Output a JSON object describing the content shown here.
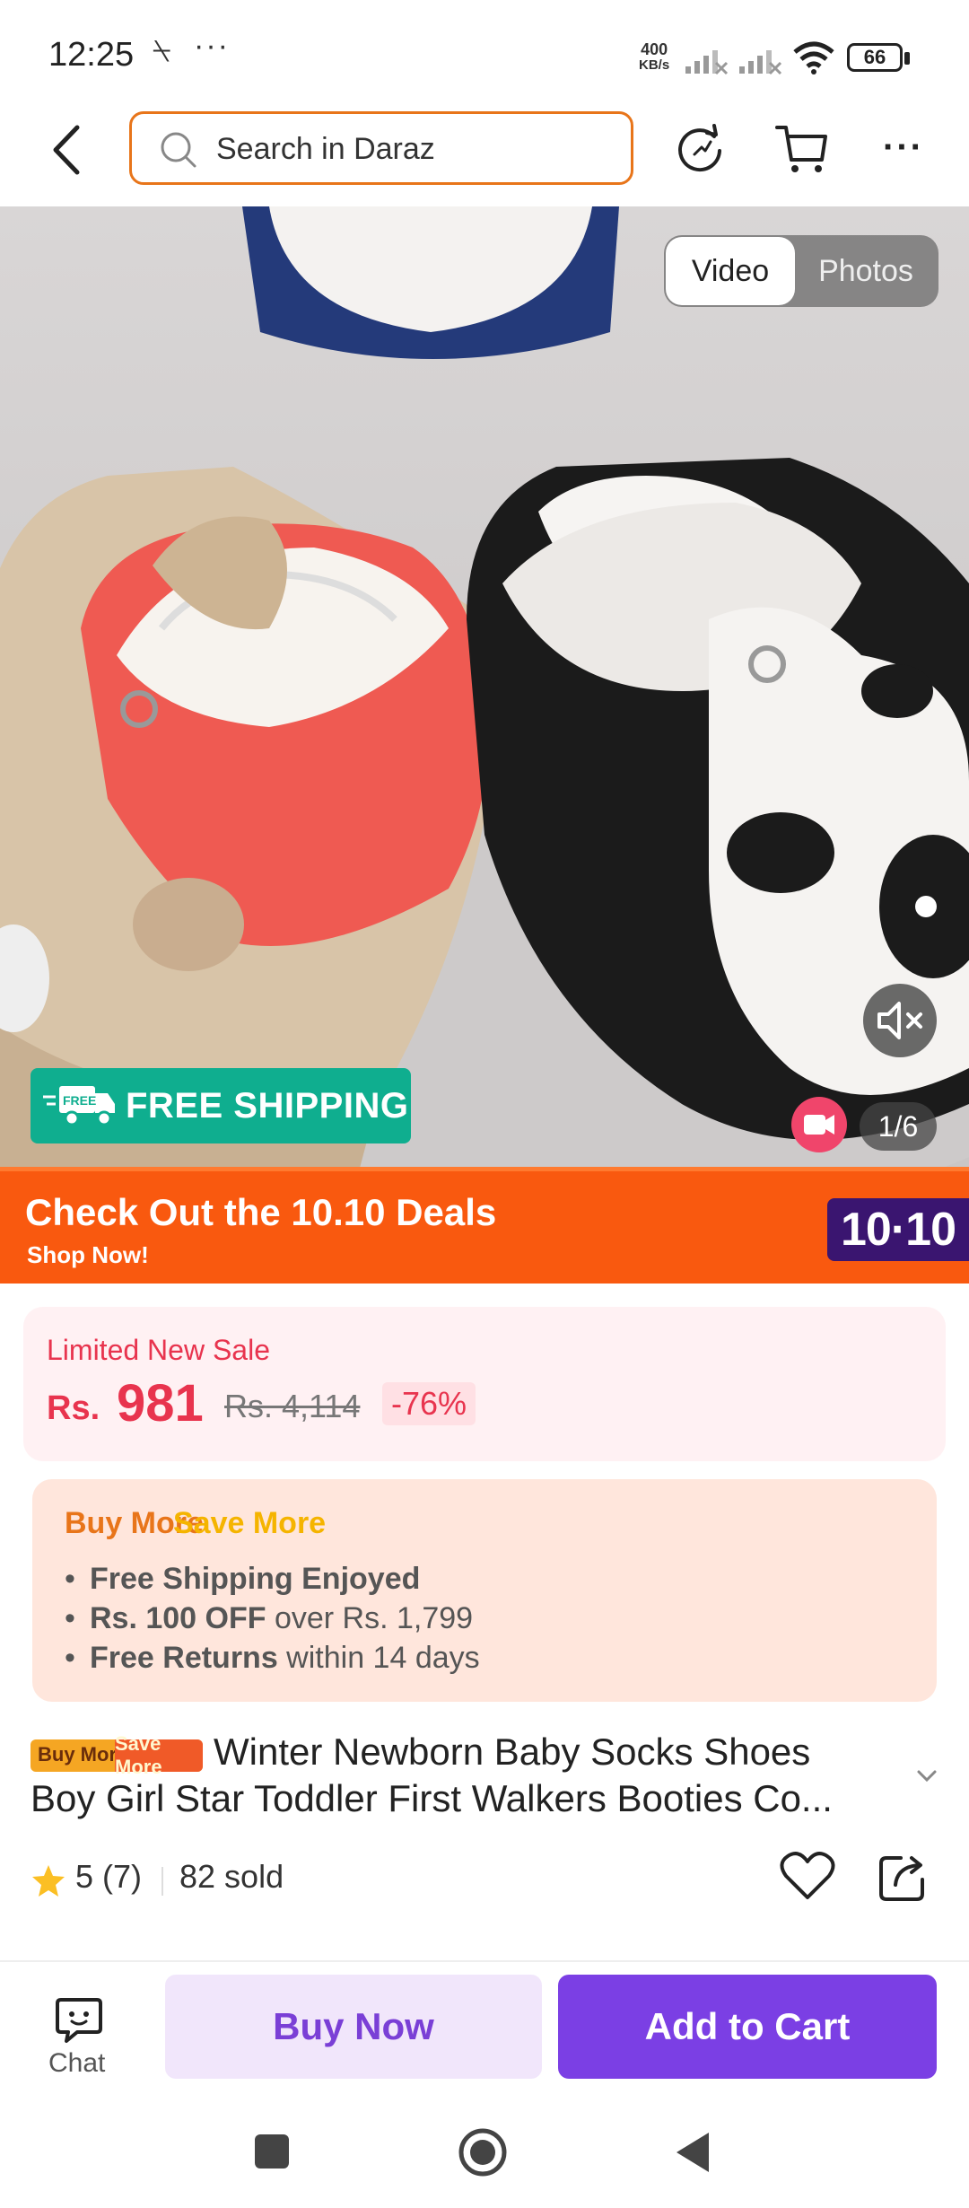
{
  "status_bar": {
    "time": "12:25",
    "net_speed_top": "400",
    "net_speed_bottom": "KB/s",
    "battery": "66"
  },
  "header": {
    "search_placeholder": "Search in Daraz"
  },
  "media": {
    "toggle_video": "Video",
    "toggle_photos": "Photos",
    "free_shipping": "FREE SHIPPING",
    "free_tag": "FREE",
    "counter": "1/6"
  },
  "banner": {
    "title": "Check Out the 10.10 Deals",
    "subtitle": "Shop Now!",
    "badge": "10·10"
  },
  "price": {
    "label": "Limited New Sale",
    "currency": "Rs.",
    "amount": "981",
    "original": "Rs. 4,114",
    "discount": "-76%"
  },
  "buy_more": {
    "title_a": "Buy More",
    "title_b": "Save More",
    "items": [
      {
        "bold": "Free Shipping Enjoyed",
        "rest": ""
      },
      {
        "bold": "Rs. 100 OFF",
        "rest": " over Rs. 1,799"
      },
      {
        "bold": "Free Returns",
        "rest": " within 14 days"
      }
    ]
  },
  "product": {
    "tag_a": "Buy More",
    "tag_b": "Save More",
    "title_line1": "Winter Newborn Baby Socks Shoes",
    "title_line2": "Boy Girl Star Toddler First Walkers Booties Co...",
    "rating": "5 (7)",
    "sold": "82 sold"
  },
  "bottom": {
    "chat": "Chat",
    "buy_now": "Buy Now",
    "add_to_cart": "Add to Cart"
  },
  "colors": {
    "accent_orange": "#e8751a",
    "price_red": "#e8344e",
    "purple": "#7b3fe4",
    "free_shipping_green": "#0fae8f",
    "banner_orange": "#f9590f"
  }
}
